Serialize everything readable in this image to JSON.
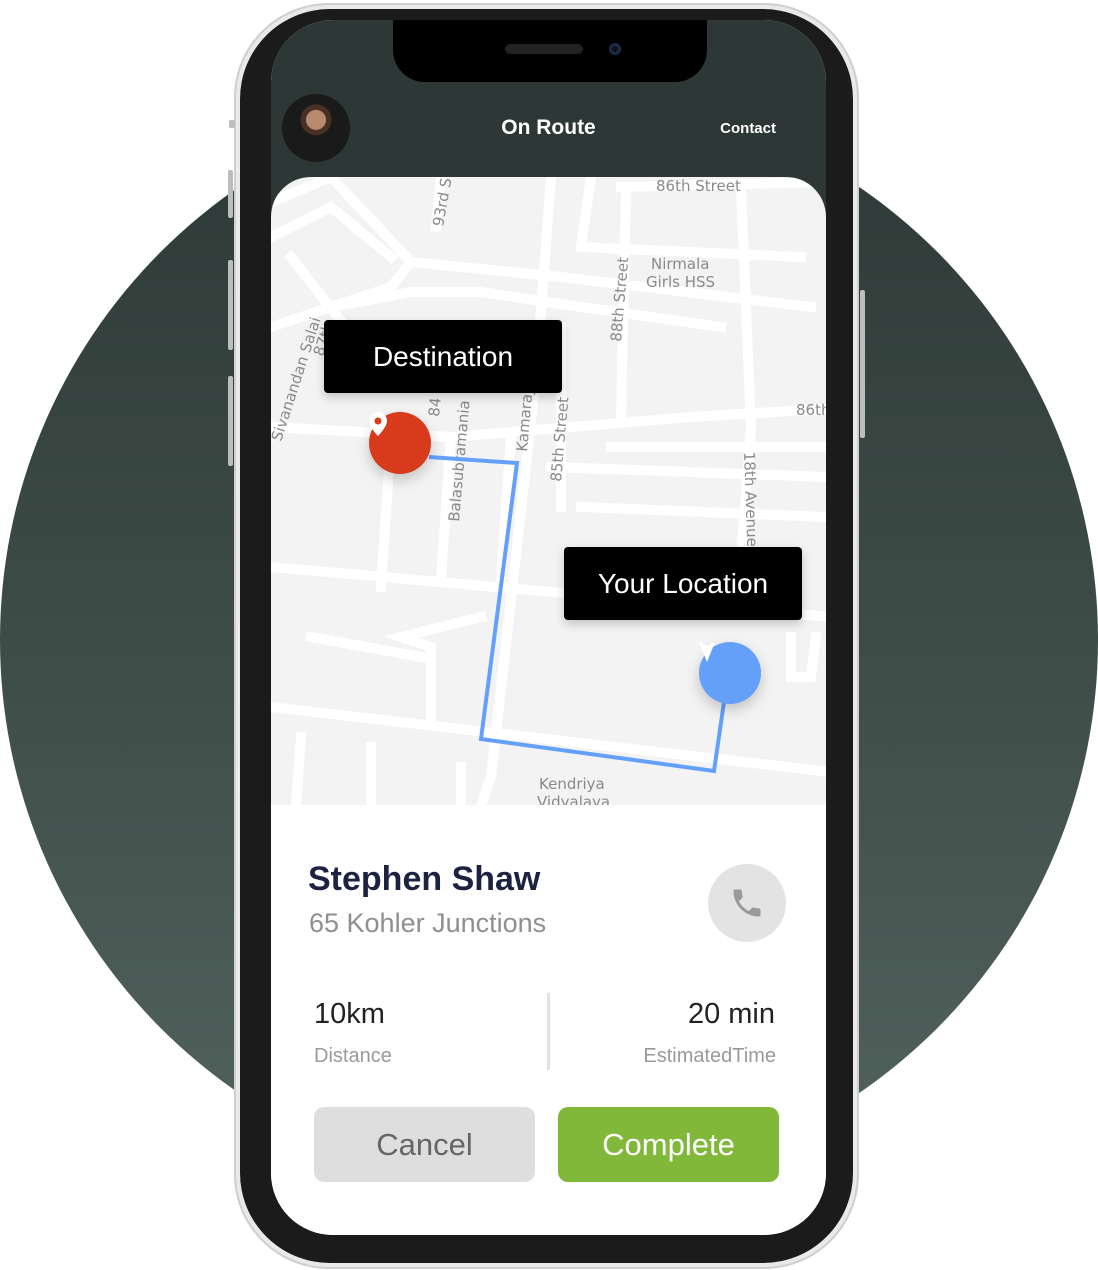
{
  "header": {
    "title": "On Route",
    "contact_label": "Contact"
  },
  "map": {
    "street_labels": [
      "86th Street",
      "93rd S",
      "Nirmala",
      "Girls HSS",
      "88th Street",
      "Sivanandan Salai",
      "87th",
      "84",
      "Balasubramania",
      "Kamarajar Salai",
      "85th Street",
      "86th",
      "18th Avenue",
      "Kendriya",
      "Vidyalaya"
    ],
    "destination_label": "Destination",
    "your_location_label": "Your Location",
    "colors": {
      "destination": "#d83a1c",
      "location": "#64a0fa",
      "route": "#64a0fa"
    }
  },
  "driver": {
    "name": "Stephen Shaw",
    "address": "65 Kohler Junctions"
  },
  "stats": {
    "distance_value": "10km",
    "distance_label": "Distance",
    "time_value": "20 min",
    "time_label": "EstimatedTime"
  },
  "actions": {
    "cancel_label": "Cancel",
    "complete_label": "Complete",
    "complete_color": "#82b83a"
  }
}
